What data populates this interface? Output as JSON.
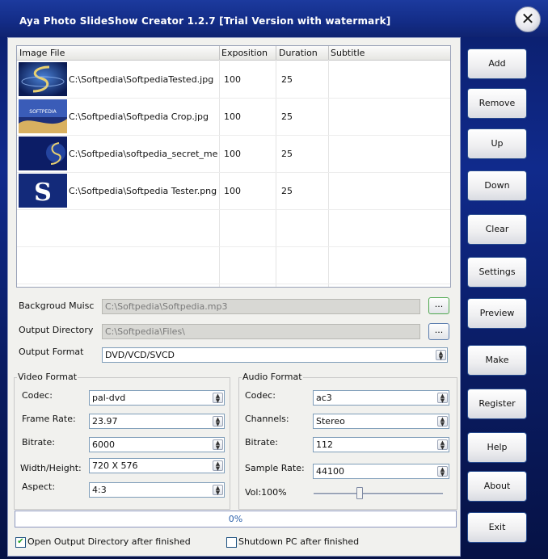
{
  "window": {
    "title": "Aya Photo SlideShow Creator 1.2.7 [Trial Version with watermark]"
  },
  "grid": {
    "columns": [
      "Image File",
      "Exposition",
      "Duration",
      "Subtitle"
    ],
    "rows": [
      {
        "file": "C:\\Softpedia\\SoftpediaTested.jpg",
        "exposition": "100",
        "duration": "25",
        "subtitle": ""
      },
      {
        "file": "C:\\Softpedia\\Softpedia Crop.jpg",
        "exposition": "100",
        "duration": "25",
        "subtitle": ""
      },
      {
        "file": "C:\\Softpedia\\softpedia_secret_mess...",
        "exposition": "100",
        "duration": "25",
        "subtitle": ""
      },
      {
        "file": "C:\\Softpedia\\Softpedia Tester.png",
        "exposition": "100",
        "duration": "25",
        "subtitle": ""
      }
    ]
  },
  "settings": {
    "bg_music_label": "Backgroud Muisc",
    "bg_music_value": "C:\\Softpedia\\Softpedia.mp3",
    "output_dir_label": "Output Directory",
    "output_dir_value": "C:\\Softpedia\\Files\\",
    "output_format_label": "Output Format",
    "output_format_value": "DVD/VCD/SVCD",
    "browse_label": "..."
  },
  "video": {
    "title": "Video Format",
    "codec_label": "Codec:",
    "codec_value": "pal-dvd",
    "frame_rate_label": "Frame Rate:",
    "frame_rate_value": "23.97",
    "bitrate_label": "Bitrate:",
    "bitrate_value": "6000",
    "wh_label": "Width/Height:",
    "wh_value": "720 X 576",
    "aspect_label": "Aspect:",
    "aspect_value": "4:3"
  },
  "audio": {
    "title": "Audio Format",
    "codec_label": "Codec:",
    "codec_value": "ac3",
    "channels_label": "Channels:",
    "channels_value": "Stereo",
    "bitrate_label": "Bitrate:",
    "bitrate_value": "112",
    "sample_rate_label": "Sample Rate:",
    "sample_rate_value": "44100",
    "vol_label": "Vol:100%",
    "volume": 0.35
  },
  "progress": {
    "text": "0%",
    "value": 0
  },
  "options": {
    "open_dir_label": "Open Output Directory after finished",
    "open_dir_checked": true,
    "shutdown_label": "Shutdown PC after finished",
    "shutdown_checked": false
  },
  "buttons": {
    "add": "Add",
    "remove": "Remove",
    "up": "Up",
    "down": "Down",
    "clear": "Clear",
    "settings": "Settings",
    "preview": "Preview",
    "make": "Make",
    "register": "Register",
    "help": "Help",
    "about": "About",
    "exit": "Exit"
  },
  "icons": {
    "close": "close-icon",
    "spinner": "updown-spinner-icon",
    "check": "checkmark-icon"
  },
  "colors": {
    "title_bar": "#132c86",
    "panel": "#f1f1ee",
    "progress_text": "#2a5faa"
  }
}
